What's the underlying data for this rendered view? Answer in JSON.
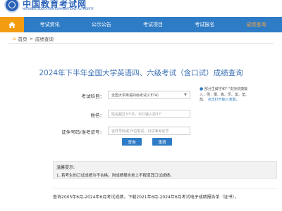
{
  "header": {
    "brand_cn": "中国教育考试网",
    "brand_en": "NATIONAL EDUCATION EXAMINATIONS AUTHORITY"
  },
  "nav": {
    "items": [
      {
        "label": "考试资讯"
      },
      {
        "label": "公示公告"
      },
      {
        "label": "考试项目"
      },
      {
        "label": "考试报名"
      },
      {
        "label": "成绩查询",
        "active": true
      }
    ]
  },
  "breadcrumb": {
    "home": "首页",
    "separator": ">",
    "current": "成绩查询"
  },
  "page": {
    "title": "2024年下半年全国大学英语四、六级考试（含口试）成绩查询"
  },
  "form": {
    "subject_label": "考试科目：",
    "subject_value": "全国大学英语四级考试(CET4)",
    "name_label": "姓名：",
    "name_placeholder": "姓名超过3个字，可只输入前3个",
    "id_label": "证件号码/准考证号：",
    "id_placeholder": "证件号码或15位笔试、口试准考证号",
    "hint_text": "部分生僻字和\"·\"支持快捷输入，例：龑、犇、衎、羕、堃、喆、",
    "hint_link": "点击打开输入表助。",
    "query_button": "查询",
    "reset_button": "重填"
  },
  "notice": {
    "title": "温馨提示:",
    "text": "1. 若考生的口试成绩为不合格，则成绩报告单上不报道其口试成绩。"
  },
  "footer": {
    "text": "查询2005年6月-2024年6月考试成绩，下载2021年6月-2024年6月考试电子成绩报告单（证书）。"
  },
  "colors": {
    "nav": "#2f7cc6",
    "accent": "#f39c12",
    "title": "#3a6fb5"
  }
}
